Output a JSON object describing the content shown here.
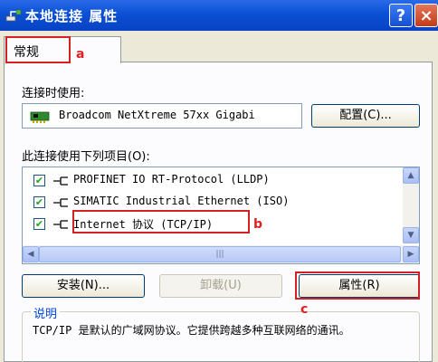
{
  "window": {
    "title": "本地连接 属性",
    "help_label": "?",
    "close_label": "×"
  },
  "tabs": [
    {
      "label": "常规"
    }
  ],
  "annotations": {
    "a": "a",
    "b": "b",
    "c": "c"
  },
  "connect_using": {
    "label": "连接时使用:",
    "adapter": "Broadcom NetXtreme 57xx Gigabi",
    "configure_button": "配置(C)..."
  },
  "items_section": {
    "label": "此连接使用下列项目(O):",
    "items": [
      {
        "text": "PROFINET IO RT-Protocol (LLDP)",
        "checked": true,
        "check_mark": "✔"
      },
      {
        "text": "SIMATIC Industrial Ethernet (ISO)",
        "checked": true,
        "check_mark": "✔"
      },
      {
        "text": "Internet 协议 (TCP/IP)",
        "checked": true,
        "check_mark": "✔"
      }
    ],
    "scroll_up": "▲",
    "scroll_down": "▼",
    "scroll_left": "◀",
    "scroll_right": "▶",
    "thumb_grip": "|||"
  },
  "buttons": {
    "install": "安装(N)...",
    "uninstall": "卸载(U)",
    "properties": "属性(R)"
  },
  "description": {
    "title": "说明",
    "text": "TCP/IP 是默认的广域网协议。它提供跨越多种互联网络的通讯。"
  },
  "colors": {
    "titlebar": "#0a4fd4",
    "annotation": "#d42020",
    "group_title": "#0046d5"
  }
}
